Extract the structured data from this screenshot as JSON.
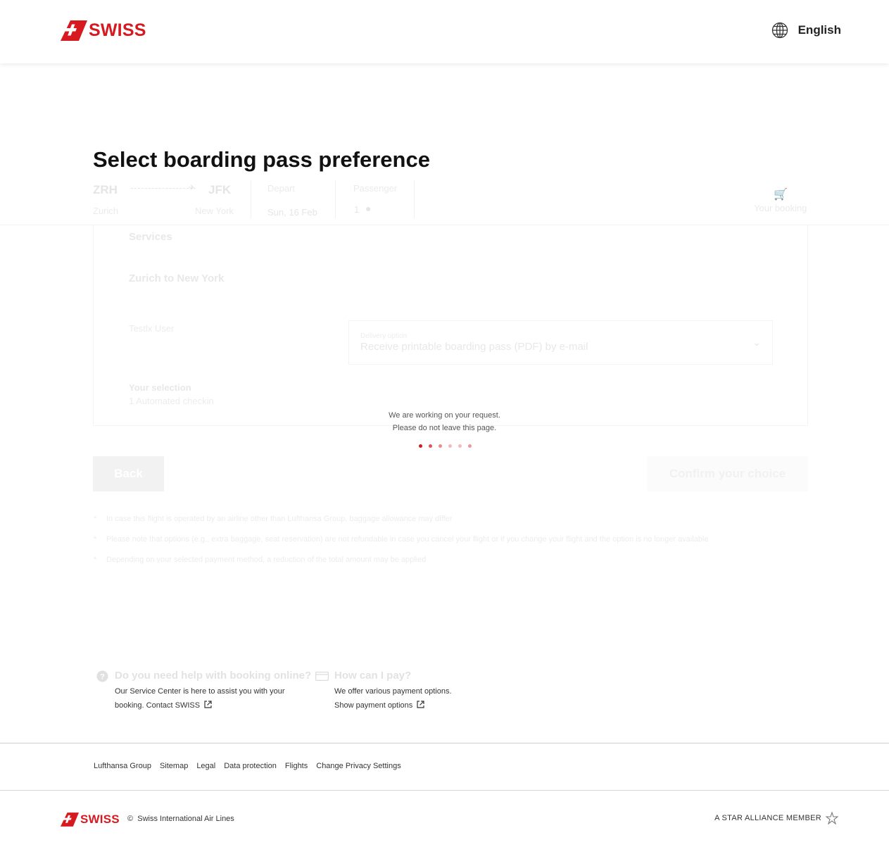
{
  "header": {
    "brand": "SWISS",
    "language": "English"
  },
  "main": {
    "title": "Select boarding pass preference"
  },
  "itinerary": {
    "origin_code": "ZRH",
    "origin_city": "Zurich",
    "dest_code": "JFK",
    "dest_city": "New York",
    "depart_label": "Depart",
    "depart_value": "Sun, 16 Feb",
    "passenger_label": "Passenger",
    "passenger_value": "1",
    "booking_label": "Your booking"
  },
  "services": {
    "heading": "Services",
    "route": "Zurich to New York",
    "passenger_name": "Testlx User",
    "delivery_label": "Delivery option",
    "delivery_value": "Receive printable boarding pass (PDF) by e-mail",
    "selection_heading": "Your selection",
    "selection_value": "1 Automated checkin"
  },
  "buttons": {
    "back": "Back",
    "confirm": "Confirm your choice"
  },
  "notes": [
    "In case this flight is operated by an airline other than Lufthansa Group, baggage allowance may differ",
    "Please note that options (e.g., extra baggage, seat reservation) are not refundable in case you cancel your flight or if you change your flight and the option is no longer available",
    "Depending on your selected payment method, a reduction of the total amount may be applied"
  ],
  "loader": {
    "line1": "We are working on your request.",
    "line2": "Please do not leave this page.",
    "dot_count": 6
  },
  "help": {
    "booking_title": "Do you need help with booking online?",
    "booking_text": "Our Service Center is here to assist you with your",
    "booking_text2": "booking.",
    "booking_link": "Contact SWISS",
    "pay_title": "How can I pay?",
    "pay_text": "We offer various payment options.",
    "pay_link": "Show payment options"
  },
  "footer": {
    "links": [
      "Lufthansa Group",
      "Sitemap",
      "Legal",
      "Data protection",
      "Flights",
      "Change Privacy Settings"
    ],
    "brand": "SWISS",
    "copyright_symbol": "©",
    "copyright": "Swiss International Air Lines",
    "alliance": "A STAR ALLIANCE MEMBER"
  },
  "colors": {
    "brand_red": "#d71920",
    "text": "#222222"
  }
}
